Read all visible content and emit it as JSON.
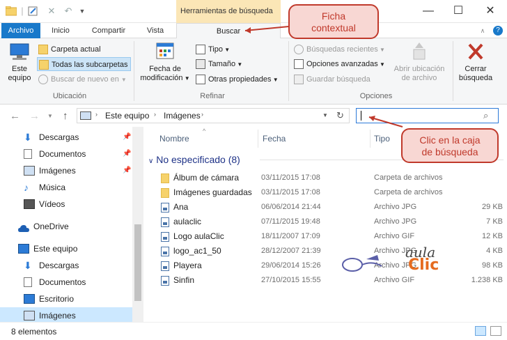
{
  "titlebar": {
    "context_tab_header": "Herramientas de búsqueda",
    "minimize": "—",
    "maximize": "☐",
    "close": "✕"
  },
  "tabs": {
    "archivo": "Archivo",
    "inicio": "Inicio",
    "compartir": "Compartir",
    "vista": "Vista",
    "buscar": "Buscar"
  },
  "ribbon": {
    "ubicacion": {
      "label": "Ubicación",
      "este_equipo": "Este equipo",
      "carpeta_actual": "Carpeta actual",
      "todas_subcarpetas": "Todas las subcarpetas",
      "buscar_nuevo": "Buscar de nuevo en"
    },
    "refinar": {
      "label": "Refinar",
      "fecha_mod_1": "Fecha de",
      "fecha_mod_2": "modificación",
      "tipo": "Tipo",
      "tamano": "Tamaño",
      "otras_propiedades": "Otras propiedades"
    },
    "opciones": {
      "label": "Opciones",
      "busquedas_recientes": "Búsquedas recientes",
      "opciones_avanzadas": "Opciones avanzadas",
      "guardar_busqueda": "Guardar búsqueda",
      "abrir_ubicacion_1": "Abrir ubicación",
      "abrir_ubicacion_2": "de archivo"
    },
    "cerrar": {
      "line1": "Cerrar",
      "line2": "búsqueda"
    }
  },
  "address": {
    "crumb1": "Este equipo",
    "crumb2": "Imágenes"
  },
  "navpane": {
    "items": [
      {
        "label": "Descargas"
      },
      {
        "label": "Documentos"
      },
      {
        "label": "Imágenes"
      },
      {
        "label": "Música"
      },
      {
        "label": "Vídeos"
      },
      {
        "label": "OneDrive"
      },
      {
        "label": "Este equipo"
      },
      {
        "label": "Descargas"
      },
      {
        "label": "Documentos"
      },
      {
        "label": "Escritorio"
      },
      {
        "label": "Imágenes"
      }
    ]
  },
  "filelist": {
    "columns": {
      "nombre": "Nombre",
      "fecha": "Fecha",
      "tipo": "Tipo"
    },
    "group": "No especificado (8)",
    "rows": [
      {
        "name": "Álbum de cámara",
        "date": "03/11/2015 17:08",
        "type": "Carpeta de archivos",
        "size": "",
        "kind": "folder"
      },
      {
        "name": "Imágenes guardadas",
        "date": "03/11/2015 17:08",
        "type": "Carpeta de archivos",
        "size": "",
        "kind": "folder"
      },
      {
        "name": "Ana",
        "date": "06/06/2014 21:44",
        "type": "Archivo JPG",
        "size": "29 KB",
        "kind": "image"
      },
      {
        "name": "aulaclic",
        "date": "07/11/2015 19:48",
        "type": "Archivo JPG",
        "size": "7 KB",
        "kind": "image"
      },
      {
        "name": "Logo aulaClic",
        "date": "18/11/2007 17:09",
        "type": "Archivo GIF",
        "size": "12 KB",
        "kind": "image"
      },
      {
        "name": "logo_ac1_50",
        "date": "28/12/2007 21:39",
        "type": "Archivo JPG",
        "size": "4 KB",
        "kind": "image"
      },
      {
        "name": "Playera",
        "date": "29/06/2014 15:26",
        "type": "Archivo JPG",
        "size": "98 KB",
        "kind": "image"
      },
      {
        "name": "Sinfin",
        "date": "27/10/2015 15:55",
        "type": "Archivo GIF",
        "size": "1.238 KB",
        "kind": "image"
      }
    ]
  },
  "status": {
    "count": "8 elementos"
  },
  "callouts": {
    "ficha_1": "Ficha",
    "ficha_2": "contextual",
    "clic_1": "Clic en la caja",
    "clic_2": "de búsqueda"
  },
  "watermark": {
    "aula": "aula",
    "clic": "Clic"
  },
  "colors": {
    "archivo_tab": "#1979ca",
    "context_header": "#fbe6b6",
    "callout_border": "#c0392b",
    "callout_fill": "#f8d7d3",
    "selected": "#cce4f7",
    "close_x": "#c0392b"
  }
}
